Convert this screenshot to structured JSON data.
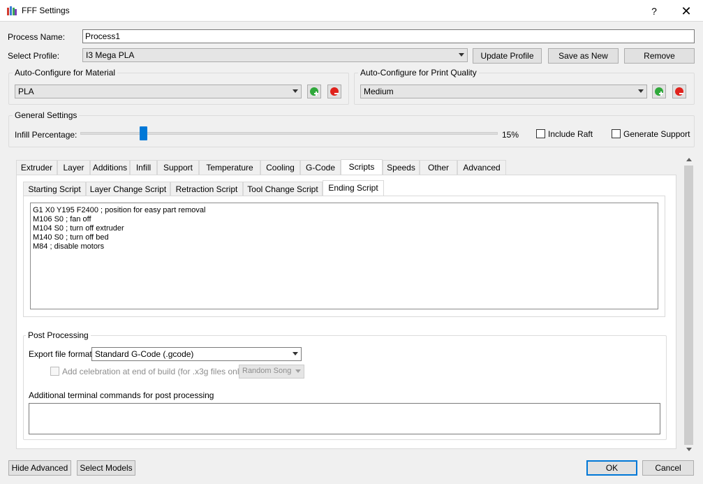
{
  "window": {
    "title": "FFF Settings",
    "help": "?",
    "close": "✕"
  },
  "process": {
    "name_label": "Process Name:",
    "name_value": "Process1"
  },
  "profile": {
    "label": "Select Profile:",
    "value": "I3 Mega PLA",
    "update": "Update Profile",
    "save_as_new": "Save as New",
    "remove": "Remove"
  },
  "material": {
    "title": "Auto-Configure for Material",
    "value": "PLA"
  },
  "quality": {
    "title": "Auto-Configure for Print Quality",
    "value": "Medium"
  },
  "general": {
    "title": "General Settings",
    "infill_label": "Infill Percentage:",
    "infill_value": "15%",
    "infill_fraction": 0.15,
    "include_raft": "Include Raft",
    "generate_support": "Generate Support"
  },
  "tabs": [
    "Extruder",
    "Layer",
    "Additions",
    "Infill",
    "Support",
    "Temperature",
    "Cooling",
    "G-Code",
    "Scripts",
    "Speeds",
    "Other",
    "Advanced"
  ],
  "active_tab": "Scripts",
  "subtabs": [
    "Starting Script",
    "Layer Change Script",
    "Retraction Script",
    "Tool Change Script",
    "Ending Script"
  ],
  "active_subtab": "Ending Script",
  "script_lines": [
    "G1 X0 Y195 F2400 ; position for easy part removal",
    "M106 S0 ; fan off",
    "M104 S0 ; turn off extruder",
    "M140 S0 ; turn off bed",
    "M84 ; disable motors"
  ],
  "post": {
    "title": "Post Processing",
    "export_label": "Export file format",
    "export_value": "Standard G-Code (.gcode)",
    "celebration_label": "Add celebration at end of build (for .x3g files only)",
    "song_value": "Random Song",
    "terminal_label": "Additional terminal commands for post processing",
    "terminal_value": ""
  },
  "footer": {
    "hide_advanced": "Hide Advanced",
    "select_models": "Select Models",
    "ok": "OK",
    "cancel": "Cancel"
  },
  "colors": {
    "accent": "#0078d7",
    "add_green": "#2fa83a",
    "remove_red": "#e0221c"
  }
}
